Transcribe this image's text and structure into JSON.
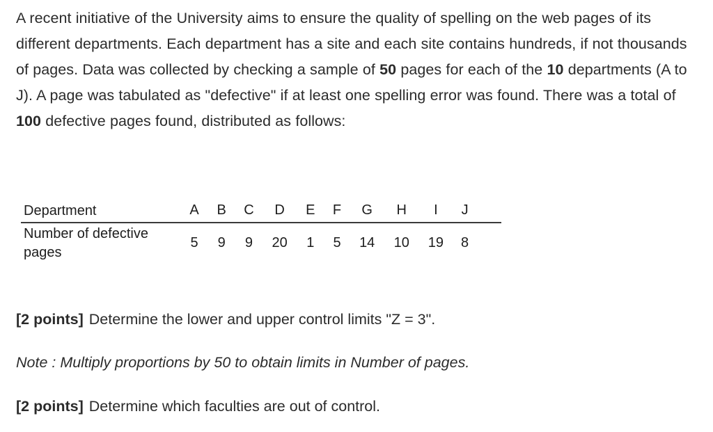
{
  "document": {
    "background_color": "#ffffff",
    "text_color": "#2b2b2b",
    "rule_color": "#3a3a3a"
  },
  "intro": {
    "segment_1": "A recent initiative of the University aims to ensure the quality of spelling on the web pages of its different departments. Each department has a site and each site contains hundreds, if not thousands of pages. Data was collected by checking a sample of ",
    "sample_size": "50",
    "segment_2": " pages for each of the ",
    "department_count": "10",
    "segment_3": " departments (A to J). A page was tabulated as \"defective\" if at least one spelling error was found. There was a total of ",
    "total_defective": "100",
    "segment_4": " defective pages found, distributed as follows:"
  },
  "table": {
    "row_header_label": "Department",
    "row_value_label": "Number of defective pages",
    "departments": [
      "A",
      "B",
      "C",
      "D",
      "E",
      "F",
      "G",
      "H",
      "I",
      "J"
    ],
    "defective_pages": [
      "5",
      "9",
      "9",
      "20",
      "1",
      "5",
      "14",
      "10",
      "19",
      "8"
    ]
  },
  "questions": [
    {
      "points_label": "[2 points]",
      "text": "Determine the lower and upper control limits \"Z = 3\".",
      "style": "normal"
    },
    {
      "points_label": "",
      "text": "Note : Multiply proportions by 50 to obtain limits in Number of pages.",
      "style": "italic"
    },
    {
      "points_label": "[2 points]",
      "text": "Determine which faculties are out of control.",
      "style": "normal"
    }
  ],
  "chart_data": {
    "type": "table",
    "title": "Number of defective pages by department",
    "categories": [
      "A",
      "B",
      "C",
      "D",
      "E",
      "F",
      "G",
      "H",
      "I",
      "J"
    ],
    "values": [
      5,
      9,
      9,
      20,
      1,
      5,
      14,
      10,
      19,
      8
    ],
    "xlabel": "Department",
    "ylabel": "Number of defective pages",
    "sample_size_per_department": 50,
    "number_of_departments": 10,
    "total_defective": 100
  }
}
